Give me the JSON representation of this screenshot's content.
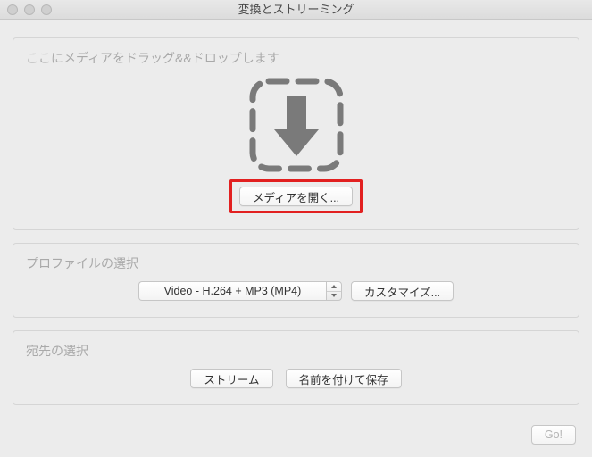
{
  "window": {
    "title": "変換とストリーミング"
  },
  "drop": {
    "title": "ここにメディアをドラッグ&&ドロップします",
    "open_button": "メディアを開く..."
  },
  "profile": {
    "title": "プロファイルの選択",
    "selected": "Video - H.264 + MP3 (MP4)",
    "customize_button": "カスタマイズ..."
  },
  "destination": {
    "title": "宛先の選択",
    "stream_button": "ストリーム",
    "save_as_button": "名前を付けて保存"
  },
  "footer": {
    "go_button": "Go!"
  }
}
